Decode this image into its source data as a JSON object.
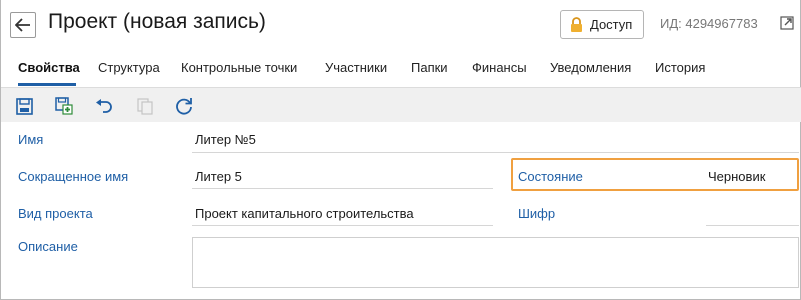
{
  "header": {
    "title": "Проект (новая запись)",
    "access_label": "Доступ",
    "id_text": "ИД: 4294967783"
  },
  "tabs": [
    {
      "label": "Свойства",
      "active": true
    },
    {
      "label": "Структура"
    },
    {
      "label": "Контрольные точки"
    },
    {
      "label": "Участники"
    },
    {
      "label": "Папки"
    },
    {
      "label": "Финансы"
    },
    {
      "label": "Уведомления"
    },
    {
      "label": "История"
    }
  ],
  "toolbar": {
    "icons": [
      "save-icon",
      "save-and-create-icon",
      "undo-icon",
      "copy-icon",
      "refresh-icon"
    ]
  },
  "form": {
    "name_label": "Имя",
    "name_value": "Литер №5",
    "short_name_label": "Сокращенное имя",
    "short_name_value": "Литер 5",
    "state_label": "Состояние",
    "state_value": "Черновик",
    "project_type_label": "Вид проекта",
    "project_type_value": "Проект капитального строительства",
    "cipher_label": "Шифр",
    "cipher_value": "",
    "description_label": "Описание",
    "description_value": ""
  },
  "colors": {
    "accent": "#1f5fa6",
    "highlight": "#f0a040",
    "toolbar_bg": "#f0f0f0"
  }
}
